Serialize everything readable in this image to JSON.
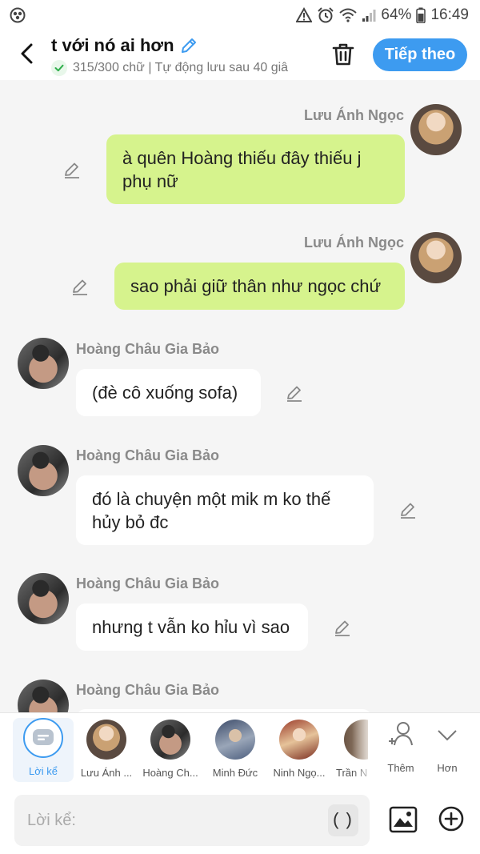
{
  "status_bar": {
    "battery": "64%",
    "time": "16:49"
  },
  "header": {
    "title": "t với nó ai hơn",
    "subtitle": "315/300 chữ | Tự động lưu sau 40 giâ",
    "next_label": "Tiếp theo"
  },
  "messages": [
    {
      "sender": "Lưu Ánh Ngọc",
      "side": "me",
      "text": "à quên Hoàng thiếu đây thiếu j phụ nữ"
    },
    {
      "sender": "Lưu Ánh Ngọc",
      "side": "me",
      "text": "sao phải giữ thân như ngọc chứ"
    },
    {
      "sender": "Hoàng Châu Gia Bảo",
      "side": "other",
      "text": "(đè cô xuống sofa)"
    },
    {
      "sender": "Hoàng Châu Gia Bảo",
      "side": "other",
      "text": "đó là chuyện một mik m ko thế hủy bỏ đc"
    },
    {
      "sender": "Hoàng Châu Gia Bảo",
      "side": "other",
      "text": "nhưng t vẫn ko hỉu vì sao"
    },
    {
      "sender": "Hoàng Châu Gia Bảo",
      "side": "other",
      "text": ""
    }
  ],
  "characters": [
    {
      "label": "Lời kể",
      "icon": "narration-icon"
    },
    {
      "label": "Lưu Ánh ..."
    },
    {
      "label": "Hoàng Ch..."
    },
    {
      "label": "Minh Đức"
    },
    {
      "label": "Ninh Ngọ..."
    },
    {
      "label": "Trần N"
    }
  ],
  "actions": {
    "add_label": "Thêm",
    "more_label": "Hơn"
  },
  "input": {
    "placeholder": "Lời kể:",
    "paren_label": "()"
  },
  "colors": {
    "accent": "#3d9bf0",
    "my_bubble": "#d6f38d",
    "other_bubble": "#ffffff",
    "background": "#f5f5f5"
  }
}
